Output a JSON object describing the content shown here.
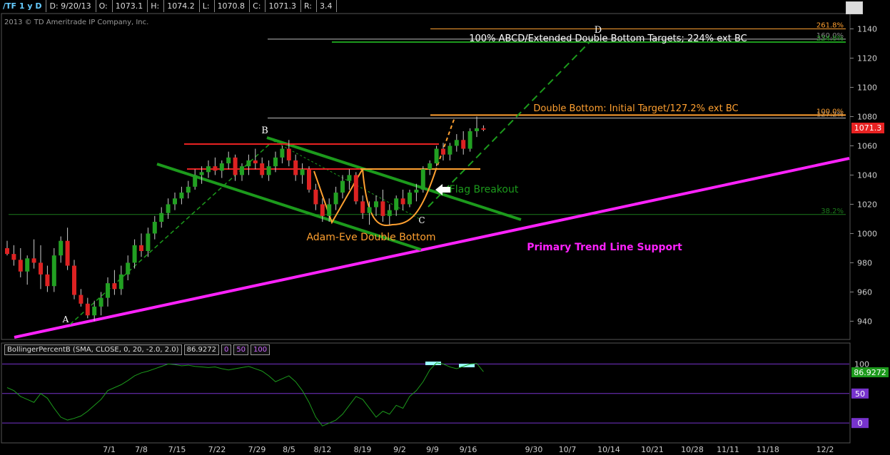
{
  "header": {
    "symbol": "/TF 1 y D",
    "date": "D: 9/20/13",
    "open": "O:",
    "open_val": "1073.1",
    "high": "H:",
    "high_val": "1074.2",
    "low": "L:",
    "low_val": "1070.8",
    "close": "C:",
    "close_val": "1071.3",
    "range": "R:",
    "range_val": "3.4"
  },
  "copyright": "2013 © TD Ameritrade IP Company, Inc.",
  "indicator": {
    "label": "BollingerPercentB (SMA, CLOSE, 0, 20, -2.0, 2.0)",
    "value": "86.9272",
    "levels": [
      "0",
      "50",
      "100"
    ]
  },
  "colors": {
    "up": "#22a022",
    "down": "#dd2222",
    "trend": "#ff22ff",
    "channel": "#1c9a1c",
    "resistance": "#e82222",
    "fib_orange": "#ffa030",
    "pattern": "#f0a030"
  },
  "chart_data": {
    "type": "candlestick",
    "price_axis": {
      "ticks": [
        940,
        960,
        980,
        1000,
        1020,
        1040,
        1060,
        1080,
        1100,
        1120,
        1140
      ],
      "range": [
        928,
        1150
      ]
    },
    "last_price": "1071.3",
    "date_ticks": [
      "7/1",
      "7/8",
      "7/15",
      "7/22",
      "7/29",
      "8/5",
      "8/12",
      "8/19",
      "9/2",
      "9/9",
      "9/16",
      "9/30",
      "10/7",
      "10/14",
      "10/21",
      "10/28",
      "11/11",
      "11/18",
      "12/2"
    ],
    "candles": [
      [
        990,
        995,
        985,
        986
      ],
      [
        986,
        992,
        978,
        982
      ],
      [
        982,
        990,
        970,
        974
      ],
      [
        974,
        985,
        965,
        983
      ],
      [
        983,
        996,
        976,
        980
      ],
      [
        980,
        992,
        962,
        972
      ],
      [
        972,
        978,
        960,
        964
      ],
      [
        964,
        990,
        960,
        985
      ],
      [
        985,
        998,
        980,
        995
      ],
      [
        995,
        1004,
        975,
        978
      ],
      [
        978,
        982,
        955,
        958
      ],
      [
        958,
        962,
        950,
        952
      ],
      [
        952,
        956,
        942,
        944
      ],
      [
        944,
        954,
        940,
        950
      ],
      [
        950,
        960,
        944,
        956
      ],
      [
        956,
        970,
        950,
        966
      ],
      [
        966,
        975,
        958,
        962
      ],
      [
        962,
        978,
        958,
        972
      ],
      [
        972,
        985,
        968,
        980
      ],
      [
        980,
        996,
        976,
        992
      ],
      [
        992,
        1000,
        984,
        988
      ],
      [
        988,
        1004,
        984,
        1000
      ],
      [
        1000,
        1012,
        996,
        1008
      ],
      [
        1008,
        1018,
        1004,
        1014
      ],
      [
        1014,
        1024,
        1010,
        1020
      ],
      [
        1020,
        1028,
        1016,
        1024
      ],
      [
        1024,
        1032,
        1020,
        1028
      ],
      [
        1028,
        1036,
        1024,
        1032
      ],
      [
        1032,
        1044,
        1030,
        1040
      ],
      [
        1040,
        1046,
        1034,
        1042
      ],
      [
        1042,
        1050,
        1038,
        1046
      ],
      [
        1046,
        1052,
        1040,
        1043
      ],
      [
        1043,
        1050,
        1038,
        1048
      ],
      [
        1048,
        1056,
        1044,
        1052
      ],
      [
        1052,
        1054,
        1036,
        1040
      ],
      [
        1040,
        1048,
        1036,
        1046
      ],
      [
        1046,
        1054,
        1040,
        1050
      ],
      [
        1050,
        1058,
        1044,
        1048
      ],
      [
        1048,
        1052,
        1038,
        1040
      ],
      [
        1040,
        1050,
        1036,
        1046
      ],
      [
        1046,
        1056,
        1042,
        1052
      ],
      [
        1052,
        1060,
        1048,
        1058
      ],
      [
        1058,
        1064,
        1046,
        1050
      ],
      [
        1050,
        1054,
        1036,
        1040
      ],
      [
        1040,
        1048,
        1034,
        1044
      ],
      [
        1044,
        1046,
        1028,
        1030
      ],
      [
        1030,
        1034,
        1016,
        1020
      ],
      [
        1020,
        1024,
        1008,
        1012
      ],
      [
        1012,
        1024,
        1008,
        1020
      ],
      [
        1020,
        1032,
        1016,
        1028
      ],
      [
        1028,
        1040,
        1024,
        1036
      ],
      [
        1036,
        1044,
        1030,
        1040
      ],
      [
        1040,
        1042,
        1020,
        1022
      ],
      [
        1022,
        1026,
        1010,
        1014
      ],
      [
        1014,
        1022,
        1006,
        1018
      ],
      [
        1018,
        1026,
        1012,
        1022
      ],
      [
        1022,
        1030,
        1008,
        1012
      ],
      [
        1012,
        1020,
        1006,
        1016
      ],
      [
        1016,
        1026,
        1012,
        1024
      ],
      [
        1024,
        1030,
        1016,
        1020
      ],
      [
        1020,
        1030,
        1018,
        1028
      ],
      [
        1028,
        1034,
        1022,
        1030
      ],
      [
        1030,
        1046,
        1028,
        1044
      ],
      [
        1044,
        1050,
        1040,
        1048
      ],
      [
        1048,
        1060,
        1046,
        1058
      ],
      [
        1058,
        1062,
        1050,
        1054
      ],
      [
        1054,
        1062,
        1050,
        1060
      ],
      [
        1060,
        1068,
        1056,
        1064
      ],
      [
        1064,
        1070,
        1054,
        1058
      ],
      [
        1058,
        1072,
        1056,
        1070
      ],
      [
        1070,
        1080,
        1066,
        1072
      ],
      [
        1072,
        1074,
        1070,
        1071
      ]
    ],
    "ma_line": {
      "from": [
        "A",
        942
      ],
      "slope_per_bar": 1.6
    },
    "levels": [
      {
        "price": 1061,
        "label": ""
      },
      {
        "price": 1044,
        "label": ""
      },
      {
        "price": 1013,
        "label": "38.2%"
      },
      {
        "price": 1079,
        "label": "127.2%"
      },
      {
        "price": 1081,
        "label": "100.0%"
      },
      {
        "price": 1133,
        "label": "160.0%"
      },
      {
        "price": 1131,
        "label": "224.0%"
      },
      {
        "price": 1140,
        "label": "261.8%"
      }
    ],
    "annotations": [
      {
        "text": "A",
        "color": "#ffffff"
      },
      {
        "text": "B",
        "color": "#ffffff"
      },
      {
        "text": "C",
        "color": "#ffffff"
      },
      {
        "text": "D",
        "color": "#ffffff"
      },
      {
        "text": "Flag Breakout",
        "color": "#1c9a1c"
      },
      {
        "text": "Adam-Eve Double Bottom",
        "color": "#ffa030"
      },
      {
        "text": "Primary Trend Line Support",
        "color": "#ff22ff"
      },
      {
        "text": "Double Bottom: Initial Target/127.2% ext BC",
        "color": "#ffa030"
      },
      {
        "text": "100% ABCD/Extended Double Bottom Targets; 224% ext BC",
        "color": "#ffffff"
      }
    ],
    "indicator_axis": {
      "ticks": [
        0,
        50,
        100
      ],
      "range": [
        -30,
        115
      ]
    },
    "percent_b": [
      60,
      55,
      45,
      40,
      35,
      50,
      42,
      25,
      10,
      5,
      8,
      12,
      20,
      30,
      40,
      55,
      60,
      65,
      72,
      80,
      85,
      88,
      92,
      96,
      100,
      99,
      97,
      98,
      96,
      95,
      94,
      95,
      92,
      90,
      92,
      94,
      96,
      92,
      88,
      80,
      70,
      75,
      80,
      70,
      55,
      35,
      10,
      -5,
      0,
      5,
      15,
      30,
      45,
      40,
      25,
      10,
      20,
      15,
      30,
      25,
      45,
      55,
      70,
      90,
      102,
      100,
      95,
      92,
      96,
      100,
      101,
      87
    ]
  }
}
